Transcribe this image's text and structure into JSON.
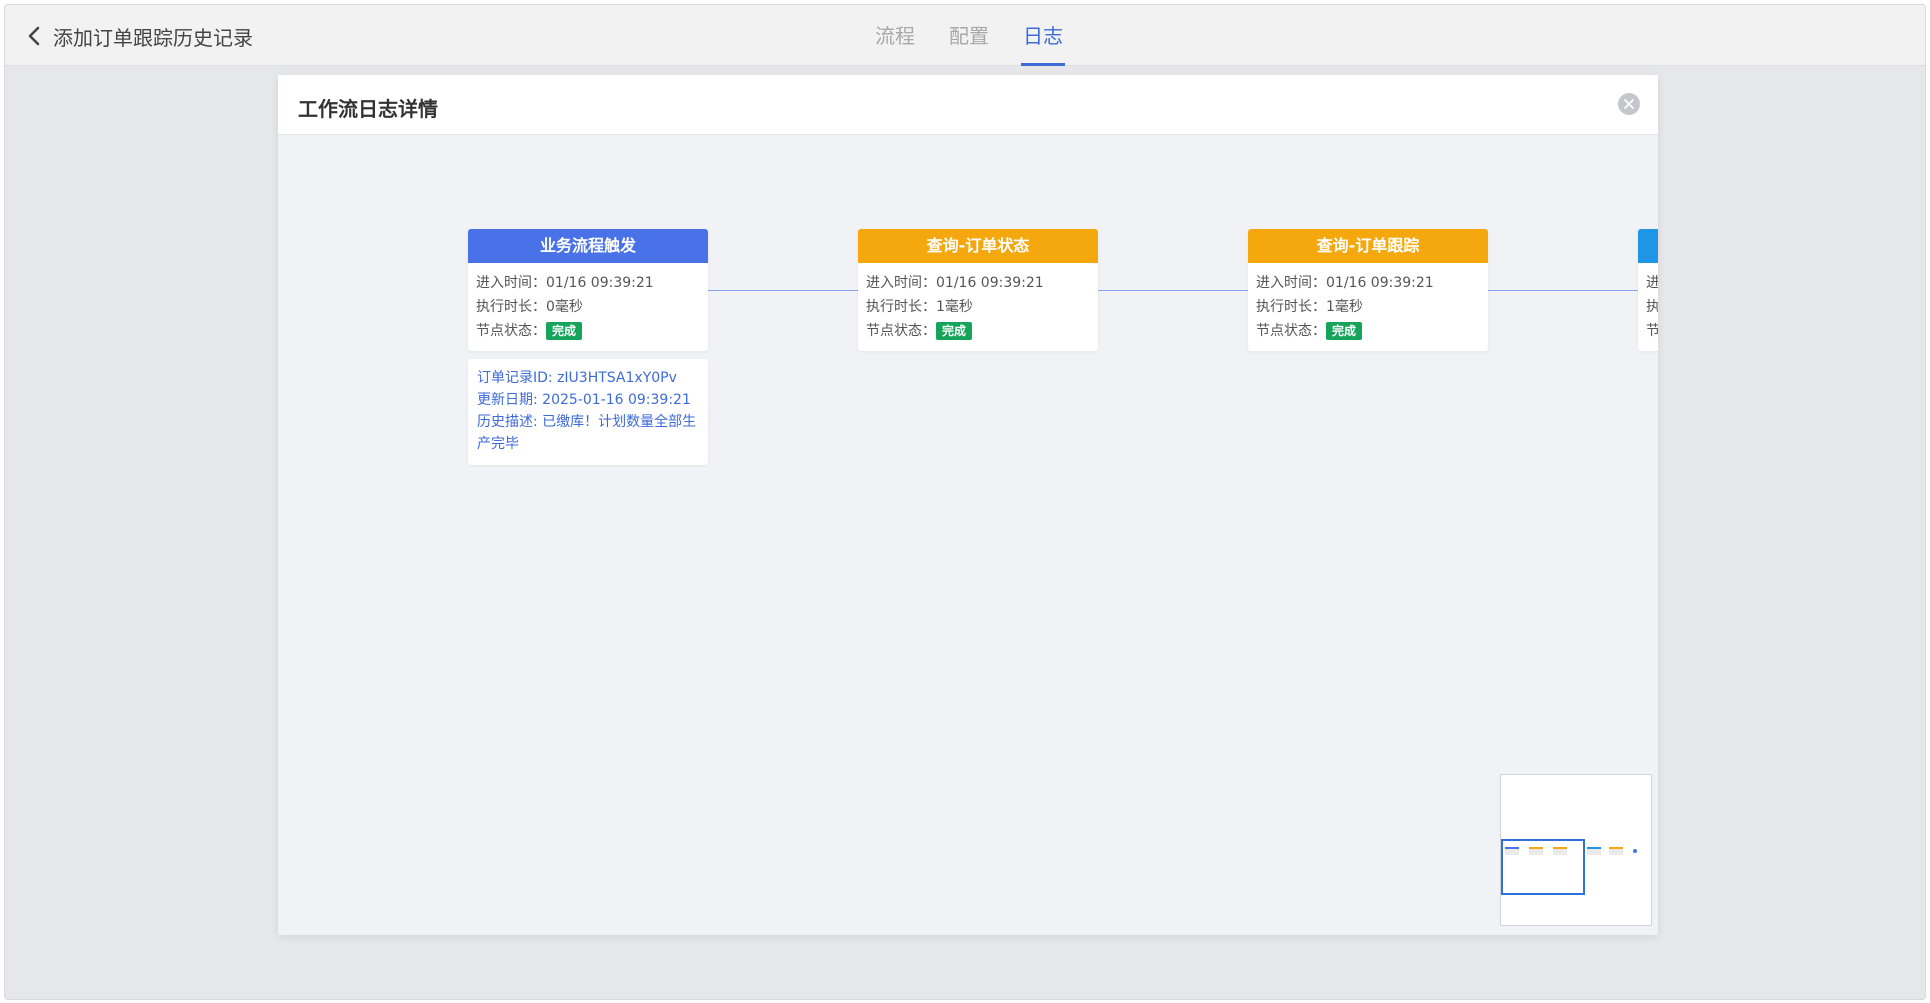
{
  "header": {
    "back_icon": "chevron-left-icon",
    "title": "添加订单跟踪历史记录",
    "tabs": [
      {
        "label": "流程",
        "active": false
      },
      {
        "label": "配置",
        "active": false
      },
      {
        "label": "日志",
        "active": true
      }
    ]
  },
  "modal": {
    "title": "工作流日志详情",
    "close_icon": "close-circle-icon"
  },
  "colors": {
    "trigger": "#4a72e8",
    "query": "#f5a80d",
    "next": "#1f95e6",
    "success_badge": "#16a35a",
    "edge": "#8aa3ee",
    "link": "#3d6bd9"
  },
  "nodes": [
    {
      "title": "业务流程触发",
      "enter_label": "进入时间：",
      "enter_time": "01/16 09:39:21",
      "duration_label": "执行时长：",
      "duration": "0毫秒",
      "status_label": "节点状态：",
      "status": "完成"
    },
    {
      "title": "查询-订单状态",
      "enter_label": "进入时间：",
      "enter_time": "01/16 09:39:21",
      "duration_label": "执行时长：",
      "duration": "1毫秒",
      "status_label": "节点状态：",
      "status": "完成"
    },
    {
      "title": "查询-订单跟踪",
      "enter_label": "进入时间：",
      "enter_time": "01/16 09:39:21",
      "duration_label": "执行时长：",
      "duration": "1毫秒",
      "status_label": "节点状态：",
      "status": "完成"
    },
    {
      "title": "",
      "enter_label": "进",
      "duration_label": "执",
      "status_label": "节"
    }
  ],
  "info": {
    "record_id": "订单记录ID: zIU3HTSA1xY0Pv",
    "update_date": "更新日期: 2025-01-16 09:39:21",
    "history_desc": "历史描述: 已缴库！计划数量全部生产完毕"
  }
}
